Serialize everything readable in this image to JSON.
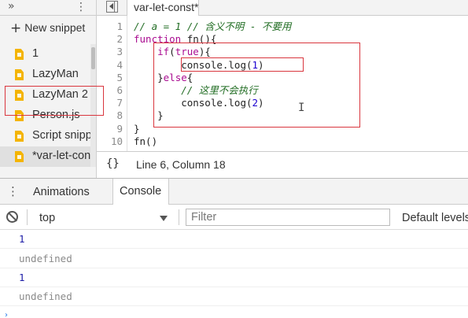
{
  "sidebar": {
    "chevrons_glyph": "»",
    "kebab_glyph": "⋮",
    "new_snippet_label": "New snippet",
    "files": [
      {
        "label": "1"
      },
      {
        "label": "LazyMan"
      },
      {
        "label": "LazyMan 2"
      },
      {
        "label": "Person.js"
      },
      {
        "label": "Script snippet"
      },
      {
        "label": "*var-let-const"
      }
    ],
    "selected_index": 5
  },
  "editor": {
    "tab_label": "var-let-const*",
    "line_numbers": [
      "1",
      "2",
      "3",
      "4",
      "5",
      "6",
      "7",
      "8",
      "9",
      "10"
    ],
    "code": {
      "l1": "// a = 1 // 含义不明 - 不要用",
      "l2_kw": "function",
      "l2_rest": " fn(){",
      "l3_indent": "    ",
      "l3_kw": "if",
      "l3_paren_open": "(",
      "l3_true": "true",
      "l3_rest": "){",
      "l4_text": "        console.log(",
      "l4_num": "1",
      "l4_close": ")",
      "l5_text": "    }",
      "l5_kw": "else",
      "l5_rest": "{",
      "l6_indent": "        ",
      "l6_cmt": "// 这里不会执行",
      "l7_text": "        console.log(",
      "l7_num": "2",
      "l7_close": ")",
      "l8": "    }",
      "l9": "}",
      "l10": "fn()"
    },
    "status": {
      "braces": "{}",
      "position": "Line 6, Column 18"
    }
  },
  "drawer": {
    "kebab_glyph": "⋮",
    "tabs": [
      {
        "label": "Animations"
      },
      {
        "label": "Console"
      }
    ],
    "active_tab": "Console",
    "toolbar": {
      "context": "top",
      "filter_placeholder": "Filter",
      "levels": "Default levels"
    },
    "messages": [
      {
        "text": "1",
        "kind": "number"
      },
      {
        "text": "undefined",
        "kind": "undefined"
      },
      {
        "text": "1",
        "kind": "number"
      },
      {
        "text": "undefined",
        "kind": "undefined"
      }
    ],
    "prompt_glyph": "›"
  },
  "colors": {
    "annotation_red": "#d9363e",
    "keyword": "#aa0d91",
    "comment": "#236e25",
    "number": "#1c00cf",
    "file_icon": "#f4b400"
  }
}
